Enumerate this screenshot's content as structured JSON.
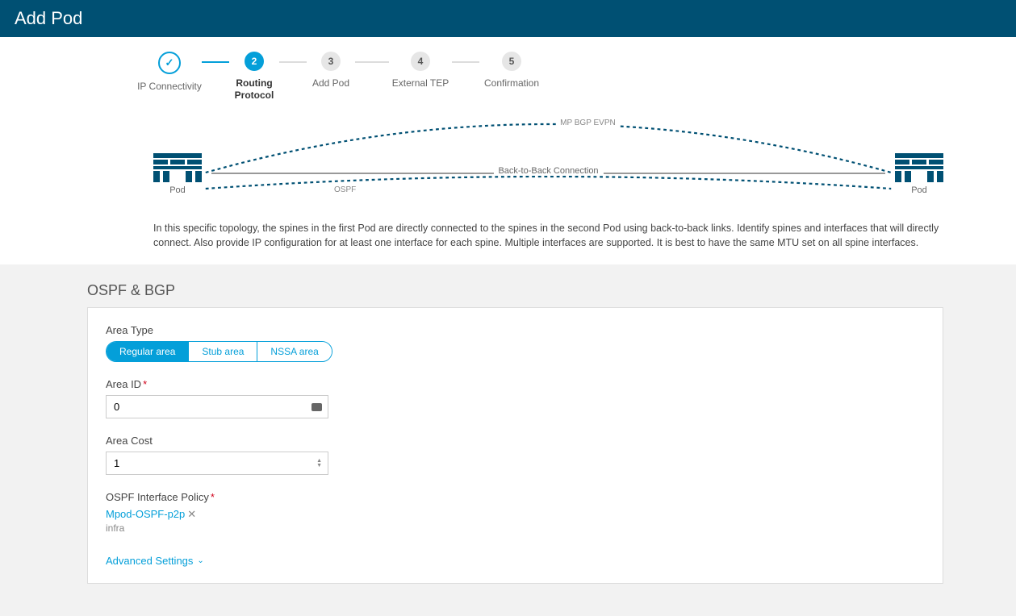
{
  "header": {
    "title": "Add Pod"
  },
  "steps": [
    {
      "label": "IP Connectivity",
      "num": "✓"
    },
    {
      "label": "Routing\nProtocol",
      "num": "2"
    },
    {
      "label": "Add Pod",
      "num": "3"
    },
    {
      "label": "External TEP",
      "num": "4"
    },
    {
      "label": "Confirmation",
      "num": "5"
    }
  ],
  "topology": {
    "left_label": "Pod",
    "right_label": "Pod",
    "connection_label": "Back-to-Back Connection",
    "ospf_label": "OSPF",
    "evpn_label": "MP BGP EVPN",
    "description": "In this specific topology, the spines in the first Pod are directly connected to the spines in the second Pod using back-to-back links. Identify spines and interfaces that will directly connect. Also provide IP configuration for at least one interface for each spine. Multiple interfaces are supported. It is best to have the same MTU set on all spine interfaces."
  },
  "form": {
    "section_title": "OSPF & BGP",
    "area_type": {
      "label": "Area Type",
      "options": [
        "Regular area",
        "Stub area",
        "NSSA area"
      ],
      "selected": "Regular area"
    },
    "area_id": {
      "label": "Area ID",
      "value": "0"
    },
    "area_cost": {
      "label": "Area Cost",
      "value": "1"
    },
    "ospf_policy": {
      "label": "OSPF Interface Policy",
      "value": "Mpod-OSPF-p2p",
      "tenant": "infra"
    },
    "advanced": "Advanced Settings"
  }
}
